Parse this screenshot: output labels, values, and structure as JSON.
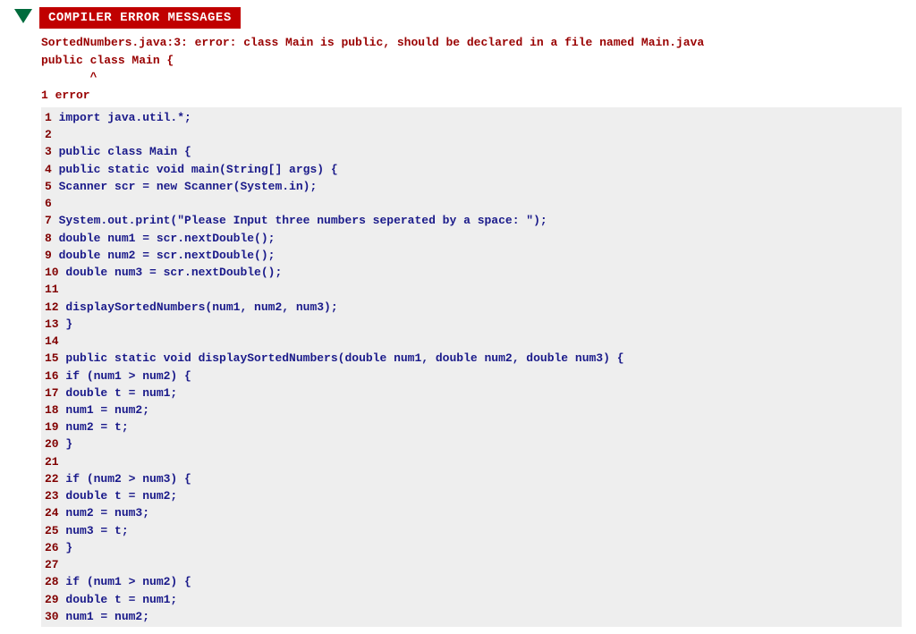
{
  "header": {
    "badge_label": "COMPILER ERROR MESSAGES"
  },
  "error": {
    "line1": "SortedNumbers.java:3: error: class Main is public, should be declared in a file named Main.java",
    "line2": "public class Main {",
    "caret": "       ^",
    "summary": "1 error"
  },
  "code": {
    "lines": [
      {
        "n": "1",
        "t": " import java.util.*;"
      },
      {
        "n": "2",
        "t": ""
      },
      {
        "n": "3",
        "t": " public class Main {"
      },
      {
        "n": "4",
        "t": " public static void main(String[] args) {"
      },
      {
        "n": "5",
        "t": " Scanner scr = new Scanner(System.in);"
      },
      {
        "n": "6",
        "t": ""
      },
      {
        "n": "7",
        "t": " System.out.print(\"Please Input three numbers seperated by a space: \");"
      },
      {
        "n": "8",
        "t": " double num1 = scr.nextDouble();"
      },
      {
        "n": "9",
        "t": " double num2 = scr.nextDouble();"
      },
      {
        "n": "10",
        "t": " double num3 = scr.nextDouble();"
      },
      {
        "n": "11",
        "t": ""
      },
      {
        "n": "12",
        "t": " displaySortedNumbers(num1, num2, num3);"
      },
      {
        "n": "13",
        "t": " }"
      },
      {
        "n": "14",
        "t": ""
      },
      {
        "n": "15",
        "t": " public static void displaySortedNumbers(double num1, double num2, double num3) {"
      },
      {
        "n": "16",
        "t": " if (num1 > num2) {"
      },
      {
        "n": "17",
        "t": " double t = num1;"
      },
      {
        "n": "18",
        "t": " num1 = num2;"
      },
      {
        "n": "19",
        "t": " num2 = t;"
      },
      {
        "n": "20",
        "t": " }"
      },
      {
        "n": "21",
        "t": ""
      },
      {
        "n": "22",
        "t": " if (num2 > num3) {"
      },
      {
        "n": "23",
        "t": " double t = num2;"
      },
      {
        "n": "24",
        "t": " num2 = num3;"
      },
      {
        "n": "25",
        "t": " num3 = t;"
      },
      {
        "n": "26",
        "t": " }"
      },
      {
        "n": "27",
        "t": ""
      },
      {
        "n": "28",
        "t": " if (num1 > num2) {"
      },
      {
        "n": "29",
        "t": " double t = num1;"
      },
      {
        "n": "30",
        "t": " num1 = num2;"
      }
    ]
  }
}
